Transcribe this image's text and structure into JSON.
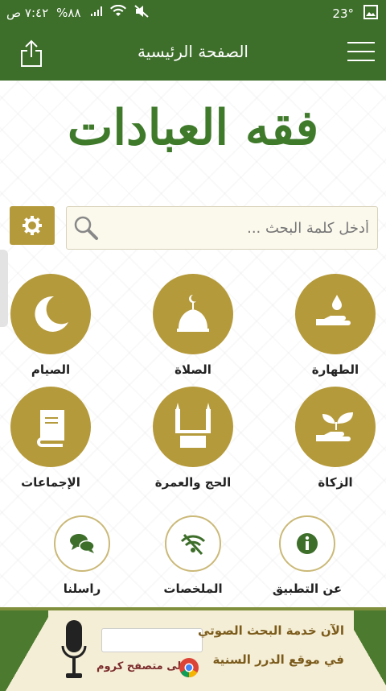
{
  "status_bar": {
    "time": "٧:٤٢ ص",
    "battery": "%٨٨",
    "temperature": "23°"
  },
  "app_bar": {
    "title": "الصفحة الرئيسية",
    "share_icon": "share-icon",
    "menu_icon": "hamburger-menu-icon"
  },
  "logo": {
    "text": "فقه العبادات"
  },
  "search": {
    "placeholder": "أدخل كلمة البحث ...",
    "settings_icon": "gear-icon",
    "search_icon": "magnifier-icon"
  },
  "categories": [
    {
      "label": "الطهارة",
      "icon": "hand-water-drop-icon"
    },
    {
      "label": "الصلاة",
      "icon": "mosque-dome-icon"
    },
    {
      "label": "الصيام",
      "icon": "crescent-moon-icon"
    },
    {
      "label": "الزكاة",
      "icon": "hand-plant-icon"
    },
    {
      "label": "الحج والعمرة",
      "icon": "kaaba-icon"
    },
    {
      "label": "الإجماعات",
      "icon": "book-icon"
    }
  ],
  "small_items": [
    {
      "label": "عن التطبيق",
      "icon": "info-icon"
    },
    {
      "label": "الملخصات",
      "icon": "summary-icon"
    },
    {
      "label": "راسلنا",
      "icon": "chat-bubbles-icon"
    }
  ],
  "banner": {
    "line1": "الآن خدمة البحث الصوتي",
    "line2": "في موقع الدرر السنية",
    "line3": "على متصفح كروم"
  },
  "colors": {
    "primary_green": "#3d6e2a",
    "gold": "#b59a3b"
  }
}
